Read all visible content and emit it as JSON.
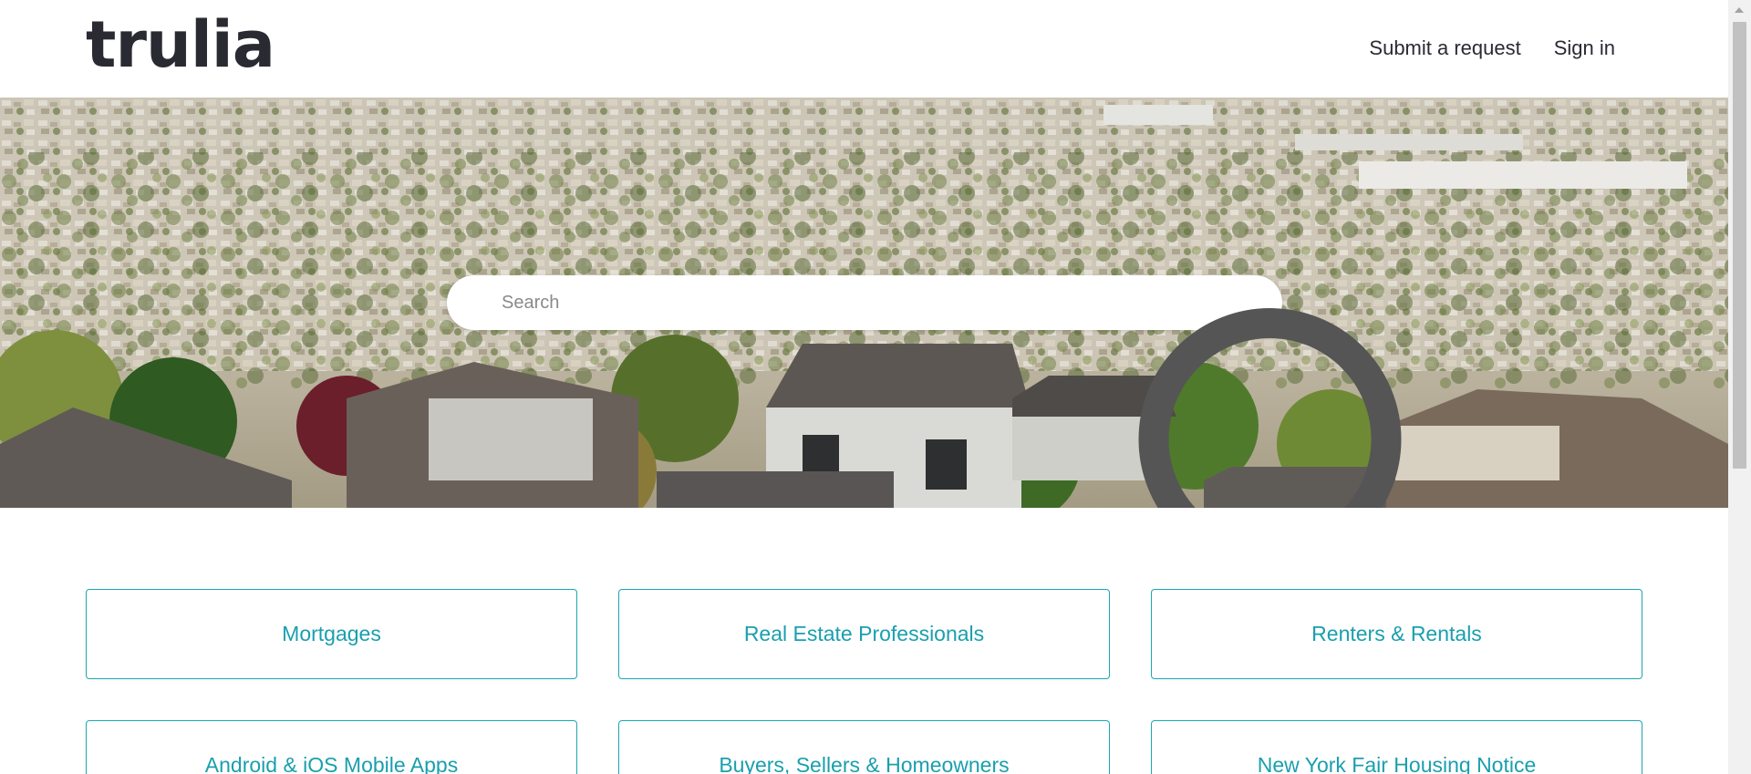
{
  "header": {
    "logo_text": "trulia",
    "nav": {
      "submit_request": "Submit a request",
      "sign_in": "Sign in"
    }
  },
  "hero": {
    "search_placeholder": "Search",
    "search_value": ""
  },
  "categories": [
    {
      "label": "Mortgages"
    },
    {
      "label": "Real Estate Professionals"
    },
    {
      "label": "Renters & Rentals"
    },
    {
      "label": "Android & iOS Mobile Apps"
    },
    {
      "label": "Buyers, Sellers & Homeowners"
    },
    {
      "label": "New York Fair Housing Notice"
    }
  ],
  "colors": {
    "accent": "#1da5b2",
    "text": "#2a2a33"
  },
  "icons": {
    "search": "search-icon"
  }
}
